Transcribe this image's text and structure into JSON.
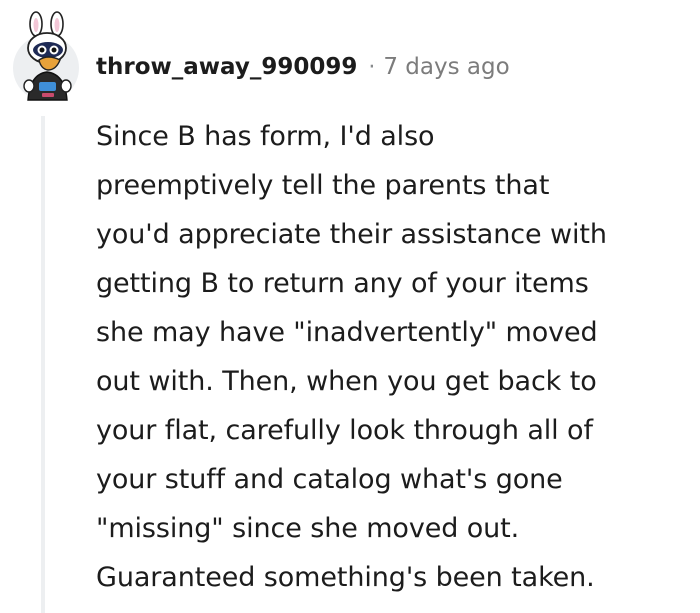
{
  "comment": {
    "author": "throw_away_990099",
    "separator": "·",
    "timestamp": "7 days ago",
    "avatar_icon": "snoo-bunny-avatar-icon",
    "body_lines": [
      "Since B has form, I'd also",
      "preemptively tell the parents that",
      "you'd appreciate their assistance with",
      "getting B to return any of your items",
      "she may have \"inadvertently\" moved",
      "out with. Then, when you get back to",
      "your flat, carefully look through all of",
      "your stuff and catalog what's gone",
      "\"missing\" since she moved out.",
      "Guaranteed something's been taken."
    ]
  },
  "colors": {
    "text": "#1c1c1c",
    "meta": "#7c7c7c",
    "thread_line": "#edeff1"
  }
}
